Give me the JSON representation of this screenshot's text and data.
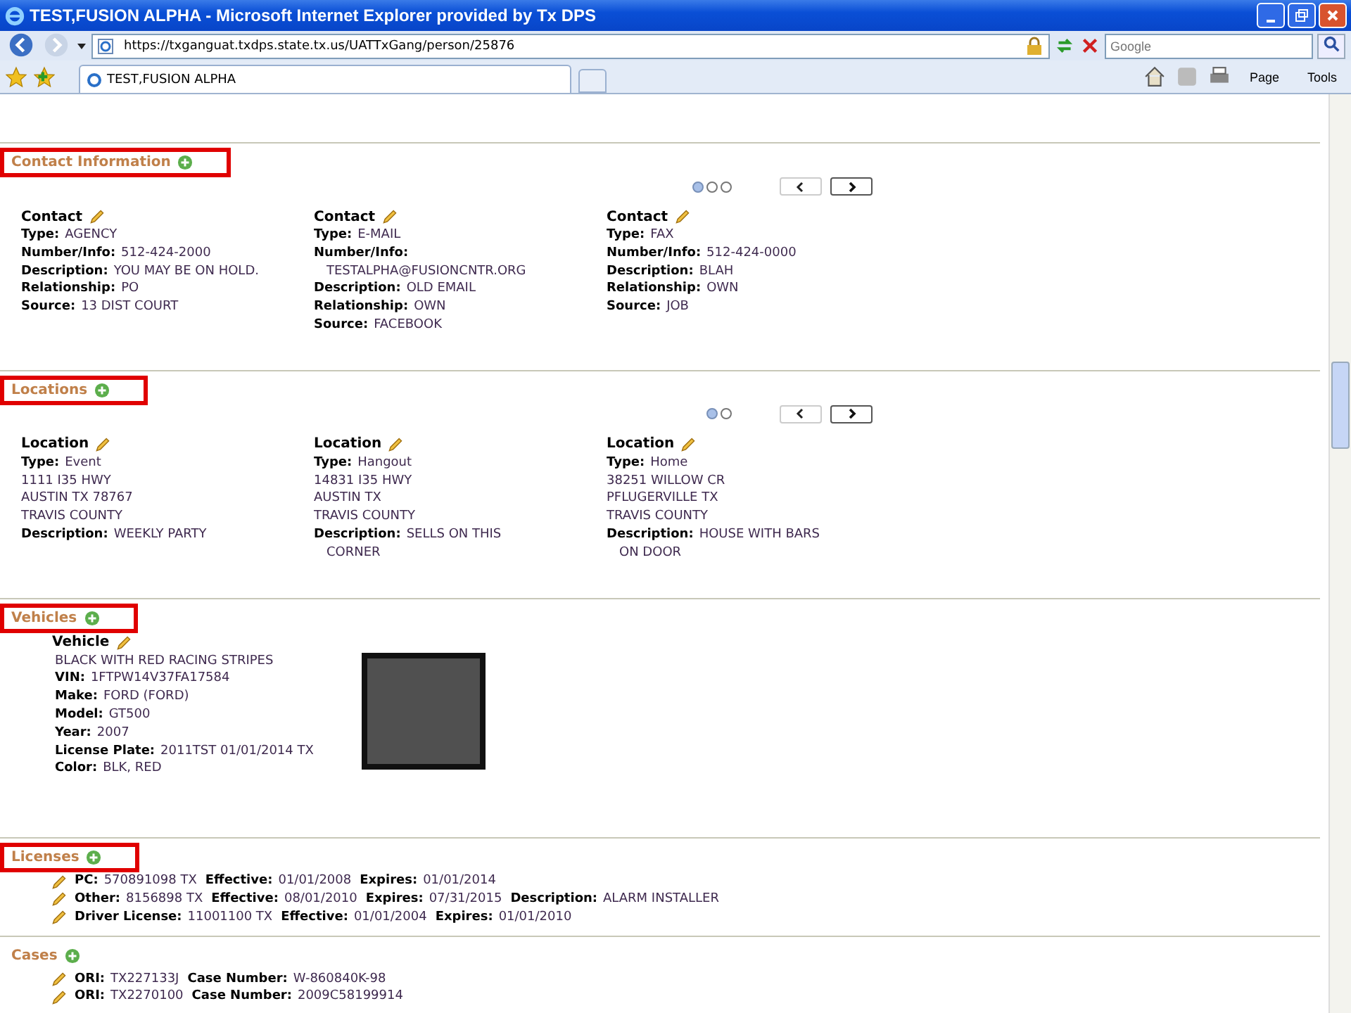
{
  "window": {
    "title": "TEST,FUSION ALPHA - Microsoft Internet Explorer provided by Tx DPS"
  },
  "address_bar": {
    "url": "https://txganguat.txdps.state.tx.us/UATTxGang/person/25876",
    "search_placeholder": "Google"
  },
  "tabs": [
    {
      "label": "TEST,FUSION ALPHA",
      "selected": true
    }
  ],
  "toolbar": {
    "page_label": "Page",
    "tools_label": "Tools"
  },
  "sections": [
    {
      "kind": "cards",
      "title": "Contact Information",
      "highlighted": true,
      "pager": [
        {
          "selected": true
        },
        {
          "selected": false
        },
        {
          "selected": false
        }
      ],
      "cards": [
        {
          "title": "Contact",
          "fields": [
            {
              "label": "Type:",
              "value": "AGENCY"
            },
            {
              "label": "Number/Info:",
              "value": "512-424-2000"
            },
            {
              "label": "Description:",
              "value": "YOU MAY BE ON HOLD."
            },
            {
              "label": "Relationship:",
              "value": "PO"
            },
            {
              "label": "Source:",
              "value": "13 DIST COURT"
            }
          ]
        },
        {
          "title": "Contact",
          "fields": [
            {
              "label": "Type:",
              "value": "E-MAIL"
            },
            {
              "label": "Number/Info:",
              "continuation": "TESTALPHA@FUSIONCNTR.ORG"
            },
            {
              "label": "Description:",
              "value": "OLD EMAIL"
            },
            {
              "label": "Relationship:",
              "value": "OWN"
            },
            {
              "label": "Source:",
              "value": "FACEBOOK"
            }
          ]
        },
        {
          "title": "Contact",
          "fields": [
            {
              "label": "Type:",
              "value": "FAX"
            },
            {
              "label": "Number/Info:",
              "value": "512-424-0000"
            },
            {
              "label": "Description:",
              "value": "BLAH"
            },
            {
              "label": "Relationship:",
              "value": "OWN"
            },
            {
              "label": "Source:",
              "value": "JOB"
            }
          ]
        }
      ]
    },
    {
      "kind": "cards",
      "title": "Locations",
      "highlighted": true,
      "pager": [
        {
          "selected": true
        },
        {
          "selected": false
        }
      ],
      "cards": [
        {
          "title": "Location",
          "fields": [
            {
              "label": "Type:",
              "value": "Event"
            },
            {
              "value": "1111 I35 HWY"
            },
            {
              "value": "AUSTIN TX 78767"
            },
            {
              "value": "TRAVIS COUNTY"
            },
            {
              "label": "Description:",
              "value": "WEEKLY PARTY"
            }
          ]
        },
        {
          "title": "Location",
          "fields": [
            {
              "label": "Type:",
              "value": "Hangout"
            },
            {
              "value": "14831 I35 HWY"
            },
            {
              "value": "AUSTIN TX"
            },
            {
              "value": "TRAVIS COUNTY"
            },
            {
              "label": "Description:",
              "value": "SELLS ON THIS",
              "continuation": "CORNER"
            }
          ]
        },
        {
          "title": "Location",
          "fields": [
            {
              "label": "Type:",
              "value": "Home"
            },
            {
              "value": "38251 WILLOW CR"
            },
            {
              "value": "PFLUGERVILLE TX"
            },
            {
              "value": "TRAVIS COUNTY"
            },
            {
              "label": "Description:",
              "value": "HOUSE WITH BARS",
              "continuation": "ON DOOR"
            }
          ]
        }
      ]
    },
    {
      "kind": "vehicle",
      "title": "Vehicles",
      "highlighted": true,
      "vehicle": {
        "title": "Vehicle",
        "fields": [
          {
            "value": "BLACK WITH RED RACING STRIPES"
          },
          {
            "label": "VIN:",
            "value": "1FTPW14V37FA17584"
          },
          {
            "label": "Make:",
            "value": "FORD (FORD)"
          },
          {
            "label": "Model:",
            "value": "GT500"
          },
          {
            "label": "Year:",
            "value": "2007"
          },
          {
            "label": "License Plate:",
            "value": "2011TST 01/01/2014 TX"
          },
          {
            "label": "Color:",
            "value": "BLK, RED"
          }
        ]
      }
    },
    {
      "kind": "list",
      "title": "Licenses",
      "highlighted": true,
      "rows": [
        [
          {
            "label": "PC:",
            "value": "570891098 TX"
          },
          {
            "label": "Effective:",
            "value": "01/01/2008"
          },
          {
            "label": "Expires:",
            "value": "01/01/2014"
          }
        ],
        [
          {
            "label": "Other:",
            "value": "8156898 TX"
          },
          {
            "label": "Effective:",
            "value": "08/01/2010"
          },
          {
            "label": "Expires:",
            "value": "07/31/2015"
          },
          {
            "label": "Description:",
            "value": "ALARM INSTALLER"
          }
        ],
        [
          {
            "label": "Driver License:",
            "value": "11001100 TX"
          },
          {
            "label": "Effective:",
            "value": "01/01/2004"
          },
          {
            "label": "Expires:",
            "value": "01/01/2010"
          }
        ]
      ]
    },
    {
      "kind": "list",
      "title": "Cases",
      "highlighted": false,
      "rows": [
        [
          {
            "label": "ORI:",
            "value": "TX227133J"
          },
          {
            "label": "Case Number:",
            "value": "W-860840K-98"
          }
        ],
        [
          {
            "label": "ORI:",
            "value": "TX2270100"
          },
          {
            "label": "Case Number:",
            "value": "2009C58199914"
          }
        ]
      ]
    }
  ]
}
